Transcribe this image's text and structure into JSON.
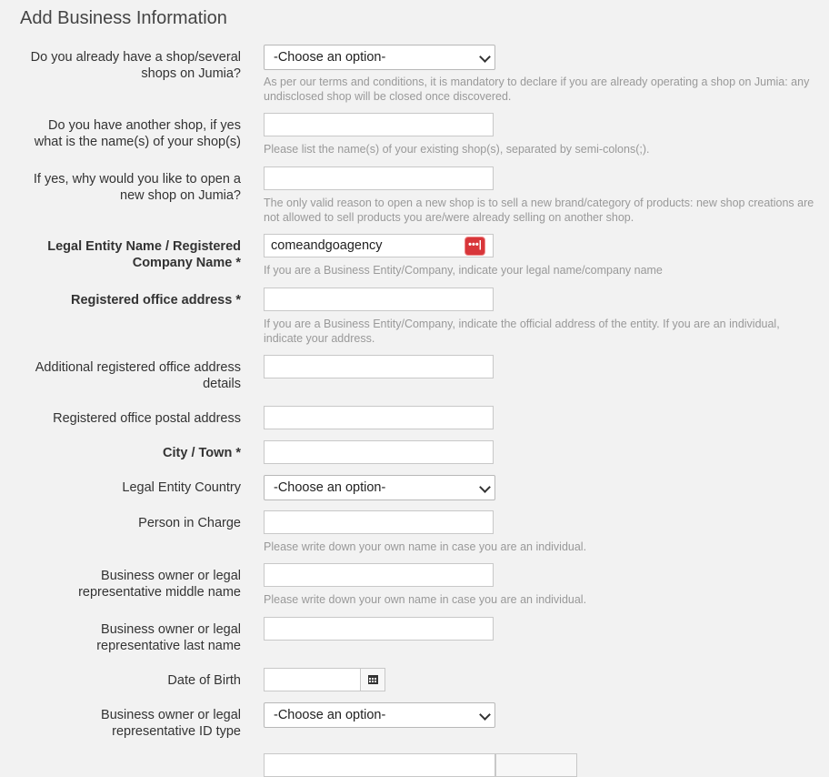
{
  "page": {
    "title": "Add Business Information"
  },
  "colors": {
    "background": "#f2f2f2",
    "help_text": "#999999",
    "password_manager": "#d8363a"
  },
  "fields": {
    "existing_shop": {
      "label": "Do you already have a shop/several shops on Jumia?",
      "value": "-Choose an option-",
      "help": "As per our terms and conditions, it is mandatory to declare if you are already operating a shop on Jumia: any undisclosed shop will be closed once discovered."
    },
    "other_shop_name": {
      "label": "Do you have another shop, if yes what is the name(s) of your shop(s)",
      "value": "",
      "help": "Please list the name(s) of your existing shop(s), separated by semi-colons(;)."
    },
    "new_shop_reason": {
      "label": "If yes, why would you like to open a new shop on Jumia?",
      "value": "",
      "help": "The only valid reason to open a new shop is to sell a new brand/category of products: new shop creations are not allowed to sell products you are/were already selling on another shop."
    },
    "legal_entity_name": {
      "label": "Legal Entity Name / Registered Company Name",
      "required": "*",
      "value": "comeandgoagency",
      "help": "If you are a Business Entity/Company, indicate your legal name/company name",
      "autofill_icon": "password-manager-icon"
    },
    "registered_office_address": {
      "label": "Registered office address",
      "required": "*",
      "value": "",
      "help": "If you are a Business Entity/Company, indicate the official address of the entity. If you are an individual, indicate your address."
    },
    "additional_address": {
      "label": "Additional registered office address details",
      "value": ""
    },
    "postal_address": {
      "label": "Registered office postal address",
      "value": ""
    },
    "city": {
      "label": "City / Town",
      "required": "*",
      "value": ""
    },
    "legal_entity_country": {
      "label": "Legal Entity Country",
      "value": "-Choose an option-"
    },
    "person_in_charge": {
      "label": "Person in Charge",
      "value": "",
      "help": "Please write down your own name in case you are an individual."
    },
    "owner_middle_name": {
      "label": "Business owner or legal representative middle name",
      "value": "",
      "help": "Please write down your own name in case you are an individual."
    },
    "owner_last_name": {
      "label": "Business owner or legal representative last name",
      "value": ""
    },
    "date_of_birth": {
      "label": "Date of Birth",
      "value": "",
      "icon": "calendar-icon"
    },
    "owner_id_type": {
      "label": "Business owner or legal representative ID type",
      "value": "-Choose an option-"
    }
  }
}
